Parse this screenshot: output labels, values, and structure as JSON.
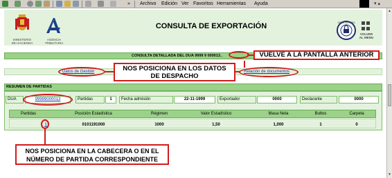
{
  "browser": {
    "menu": [
      "Archivo",
      "Edición",
      "Ver",
      "Favoritos",
      "Herramientas",
      "Ayuda"
    ],
    "more_toolbar": "»",
    "toolbar_icons": [
      "back-icon",
      "forward-icon",
      "stop-icon",
      "refresh-icon",
      "home-icon",
      "search-icon",
      "favorites-icon",
      "history-icon",
      "mail-icon",
      "print-icon",
      "edit-icon"
    ]
  },
  "header": {
    "title": "CONSULTA DE EXPORTACIÓN",
    "ministry_logo_text": "MINISTERIO\nDE HACIENDA",
    "agency_logo_text": "AGENCIA\nTRIBUTARIA",
    "seal_text": "AREA SEGURA",
    "back_to_menu": "VOLVER\nAL MENU"
  },
  "detail_bar": {
    "text": "CONSULTA DETALLADA DEL DUA 9999 9 000013.."
  },
  "links": {
    "datos_gestion": "Datos de Gestión",
    "relacion_documentos": "Relación de documentos"
  },
  "resumen": {
    "label": "RESUMEN DE PARTIDAS",
    "dua_label": "DUA",
    "dua_value": "99999000013",
    "partidas_label": "Partidas",
    "partidas_value": "1",
    "fecha_label": "Fecha admisión",
    "fecha_value": "22-11-1999",
    "exportador_label": "Exportador",
    "exportador_value": "0000",
    "declarante_label": "Declarante",
    "declarante_value": "0000"
  },
  "items_table": {
    "columns": [
      "Partidas",
      "Posición Estadística",
      "Régimen",
      "Valor Estadístico",
      "Masa Neta",
      "Bultos",
      "Carpeta"
    ],
    "row": [
      "1",
      "0101191000",
      "1000",
      "1,50",
      "1,000",
      "1",
      "0"
    ]
  },
  "annotations": {
    "vuelve": "VUELVE A LA PANTALLA ANTERIOR",
    "despacho": "NOS POSICIONA EN LOS DATOS\nDE DESPACHO",
    "cabecera": "NOS POSICIONA EN LA CABECERA O EN EL\nNÚMERO DE PARTIDA CORRESPONDIENTE"
  },
  "colors": {
    "header_bg": "#e3f2dd",
    "bar_green": "#9bd189",
    "annotation_red": "#d11a1a",
    "link_blue": "#1f2aa8"
  }
}
